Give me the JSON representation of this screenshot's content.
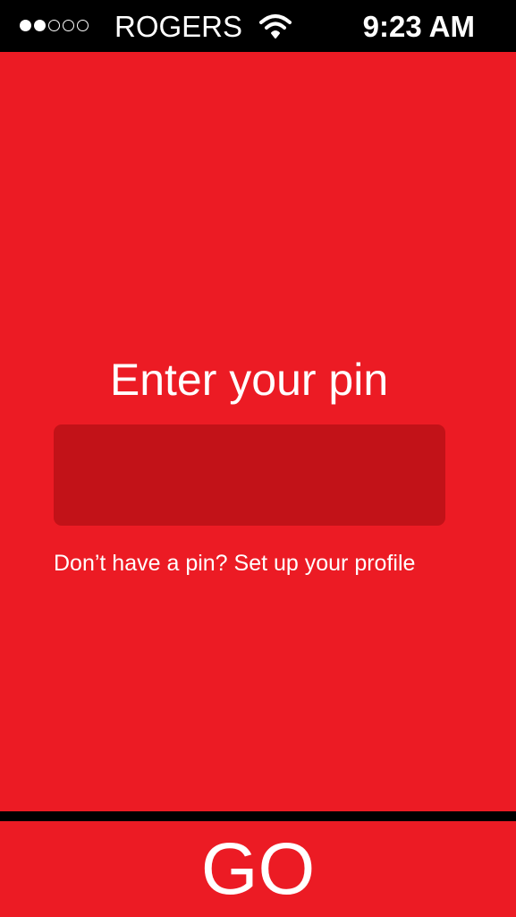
{
  "status_bar": {
    "signal": [
      "filled",
      "filled",
      "empty",
      "empty",
      "empty"
    ],
    "carrier": "ROGERS",
    "wifi_icon": "wifi-icon",
    "time": "9:23 AM"
  },
  "pin_screen": {
    "title": "Enter your pin",
    "pin_value": "",
    "pin_placeholder": "",
    "setup_link": "Don’t have a pin? Set up your profile"
  },
  "footer": {
    "go_label": "GO"
  },
  "colors": {
    "background": "#ec1b24",
    "input_background": "#c21218",
    "status_bar": "#000000",
    "text": "#ffffff"
  }
}
